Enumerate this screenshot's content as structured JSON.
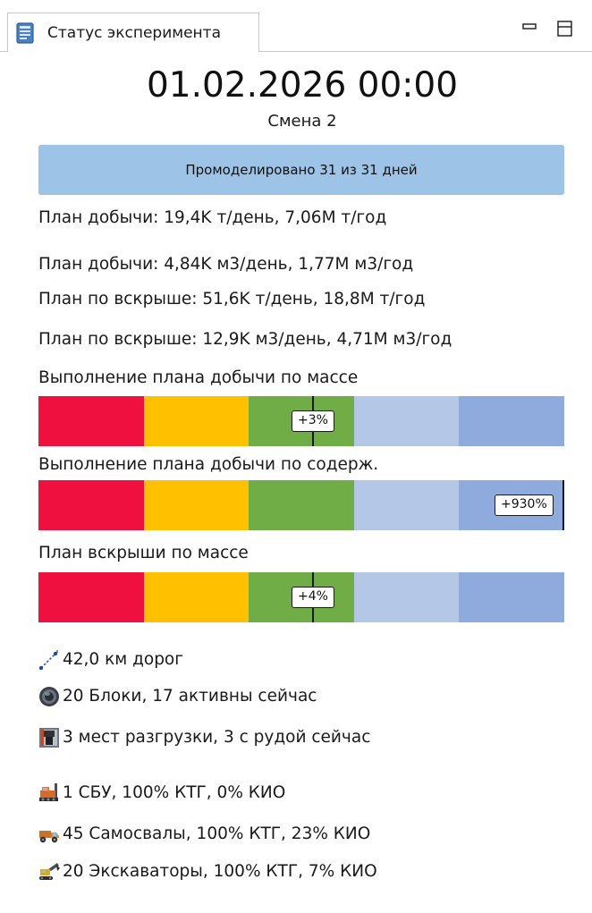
{
  "panel": {
    "tab_title": "Статус эксперимента",
    "tab_icon": "document-icon",
    "minimize_icon": "minimize-icon",
    "maximize_icon": "maximize-icon"
  },
  "header": {
    "datetime": "01.02.2026 00:00",
    "shift": "Смена 2"
  },
  "progress": {
    "label": "Промоделировано 31 из 31 дней",
    "fraction": 1.0
  },
  "plan_lines": [
    "План добычи: 19,4K т/день, 7,06M т/год",
    "План добычи: 4,84K м3/день, 1,77M м3/год",
    "План по вскрыше: 51,6K т/день, 18,8M т/год",
    "План по вскрыше: 12,9K м3/день, 4,71M м3/год"
  ],
  "colors": {
    "red": "#f01040",
    "orange": "#ffc000",
    "green": "#70ad47",
    "light_blue": "#b4c7e7",
    "blue": "#8faadc",
    "banner": "#9dc3e6"
  },
  "gauges": [
    {
      "title": "Выполнение плана добычи по массе",
      "badge": "+3%",
      "marker_fraction": 0.522
    },
    {
      "title": "Выполнение плана добычи по содерж.",
      "badge": "+930%",
      "marker_fraction": 0.999
    },
    {
      "title": "План вскрыши по массе",
      "badge": "+4%",
      "marker_fraction": 0.522
    }
  ],
  "stats": [
    {
      "icon": "road-icon",
      "text": "42,0 км дорог"
    },
    {
      "icon": "block-icon",
      "text": "20 Блоки, 17 активны сейчас"
    },
    {
      "icon": "unload-point-icon",
      "text": "3 мест разгрузки, 3 с рудой сейчас"
    },
    {
      "icon": "drill-rig-icon",
      "text": "1 СБУ, 100% КТГ, 0% КИО"
    },
    {
      "icon": "dump-truck-icon",
      "text": "45 Самосвалы, 100% КТГ, 23% КИО"
    },
    {
      "icon": "excavator-icon",
      "text": "20 Экскаваторы, 100% КТГ, 7% КИО"
    }
  ]
}
